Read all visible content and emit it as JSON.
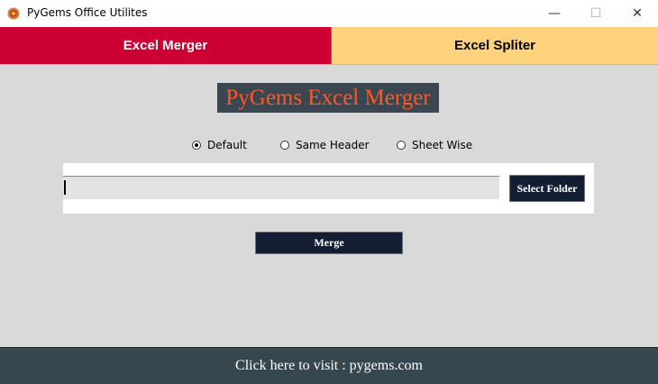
{
  "window": {
    "title": "PyGems Office Utilites",
    "minimize_glyph": "—",
    "maximize_glyph": "☐",
    "close_glyph": "✕"
  },
  "tabs": [
    {
      "label": "Excel Merger",
      "active": true,
      "color": "#cc0033"
    },
    {
      "label": "Excel Spliter",
      "active": false,
      "color": "#fcd27c"
    }
  ],
  "main": {
    "heading": "PyGems Excel Merger",
    "heading_color": "#ff5722",
    "options": [
      {
        "label": "Default",
        "selected": true
      },
      {
        "label": "Same Header",
        "selected": false
      },
      {
        "label": "Sheet Wise",
        "selected": false
      }
    ],
    "path_value": "",
    "select_folder_label": "Select Folder",
    "merge_label": "Merge"
  },
  "footer": {
    "link_text": "Click here to visit : pygems.com"
  },
  "icons": {
    "app": "pygems-logo-icon"
  }
}
